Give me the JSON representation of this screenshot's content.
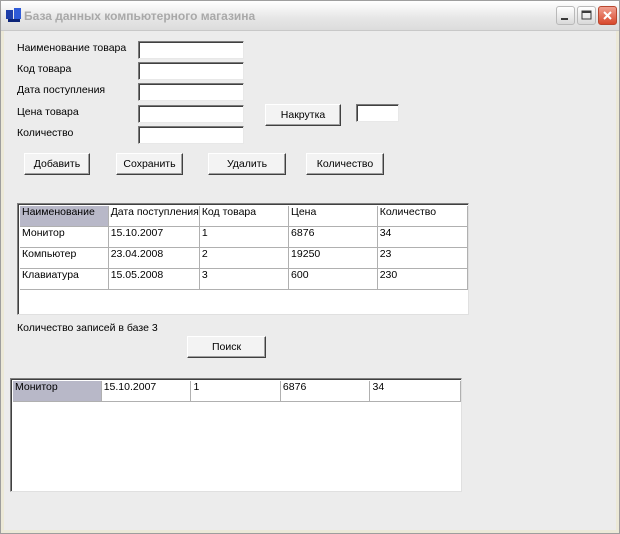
{
  "window": {
    "title": "База данных компьютерного магазина",
    "icon": "database-app-icon"
  },
  "form": {
    "labels": {
      "name": "Наименование товара",
      "code": "Код товара",
      "date": "Дата поступления",
      "price": "Цена товара",
      "qty": "Количество"
    },
    "values": {
      "name": "",
      "code": "",
      "date": "",
      "price": "",
      "qty": ""
    },
    "markup_button": "Накрутка",
    "markup_value": ""
  },
  "actions": {
    "add": "Добавить",
    "save": "Сохранить",
    "delete": "Удалить",
    "count": "Количество"
  },
  "table": {
    "columns": [
      "Наименование",
      "Дата поступления",
      "Код товара",
      "Цена",
      "Количество"
    ],
    "rows": [
      [
        "Монитор",
        "15.10.2007",
        "1",
        "6876",
        "34"
      ],
      [
        "Компьютер",
        "23.04.2008",
        "2",
        "19250",
        "23"
      ],
      [
        "Клавиатура",
        "15.05.2008",
        "3",
        "600",
        "230"
      ]
    ]
  },
  "record_count_text": "Количество записей в базе 3",
  "search_button": "Поиск",
  "results": {
    "rows": [
      [
        "Монитор",
        "15.10.2007",
        "1",
        "6876",
        "34"
      ]
    ]
  }
}
